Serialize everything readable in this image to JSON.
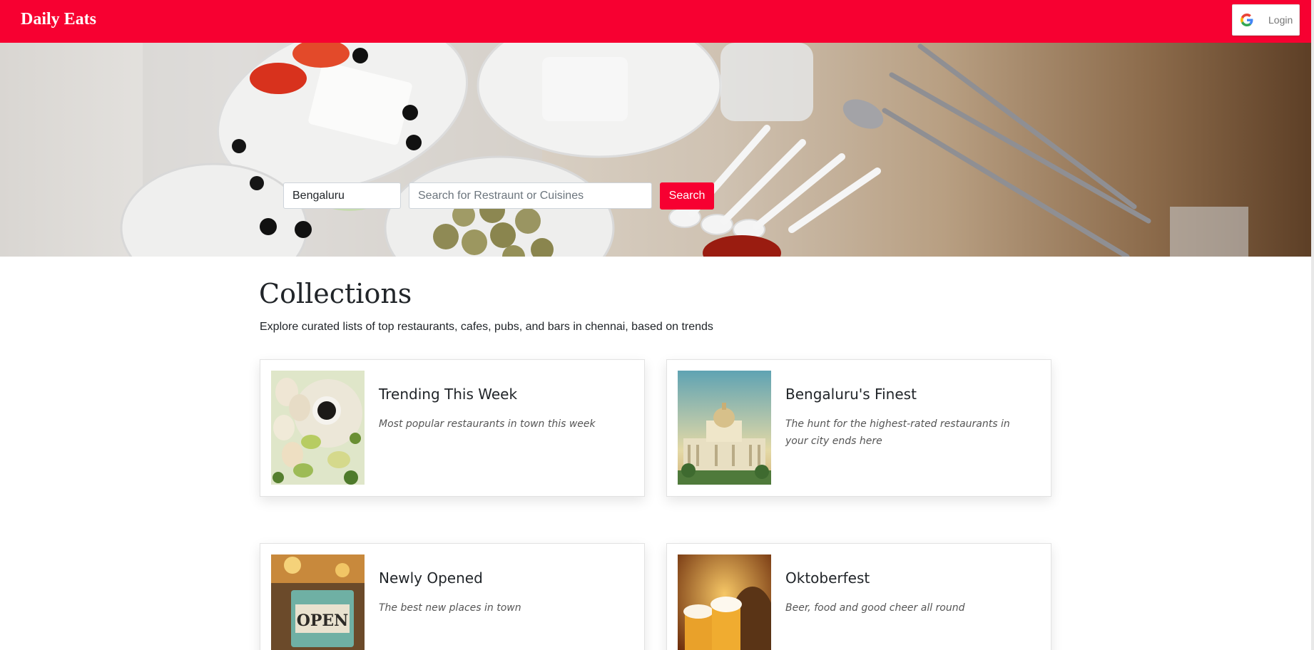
{
  "header": {
    "brand": "Daily Eats",
    "login_label": "Login"
  },
  "search": {
    "city_value": "Bengaluru",
    "query_placeholder": "Search for Restraunt or Cuisines",
    "button_label": "Search"
  },
  "collections": {
    "title": "Collections",
    "subtitle": "Explore curated lists of top restaurants, cafes, pubs, and bars in chennai, based on trends",
    "cards": [
      {
        "title": "Trending This Week",
        "description": "Most popular restaurants in town this week"
      },
      {
        "title": "Bengaluru's Finest",
        "description": "The hunt for the highest-rated restaurants in your city ends here"
      },
      {
        "title": "Newly Opened",
        "description": "The best new places in town"
      },
      {
        "title": "Oktoberfest",
        "description": "Beer, food and good cheer all round"
      }
    ]
  },
  "colors": {
    "brand": "#f70031",
    "card_border": "#e2e2e2"
  },
  "icons": {
    "login": "google-icon"
  }
}
